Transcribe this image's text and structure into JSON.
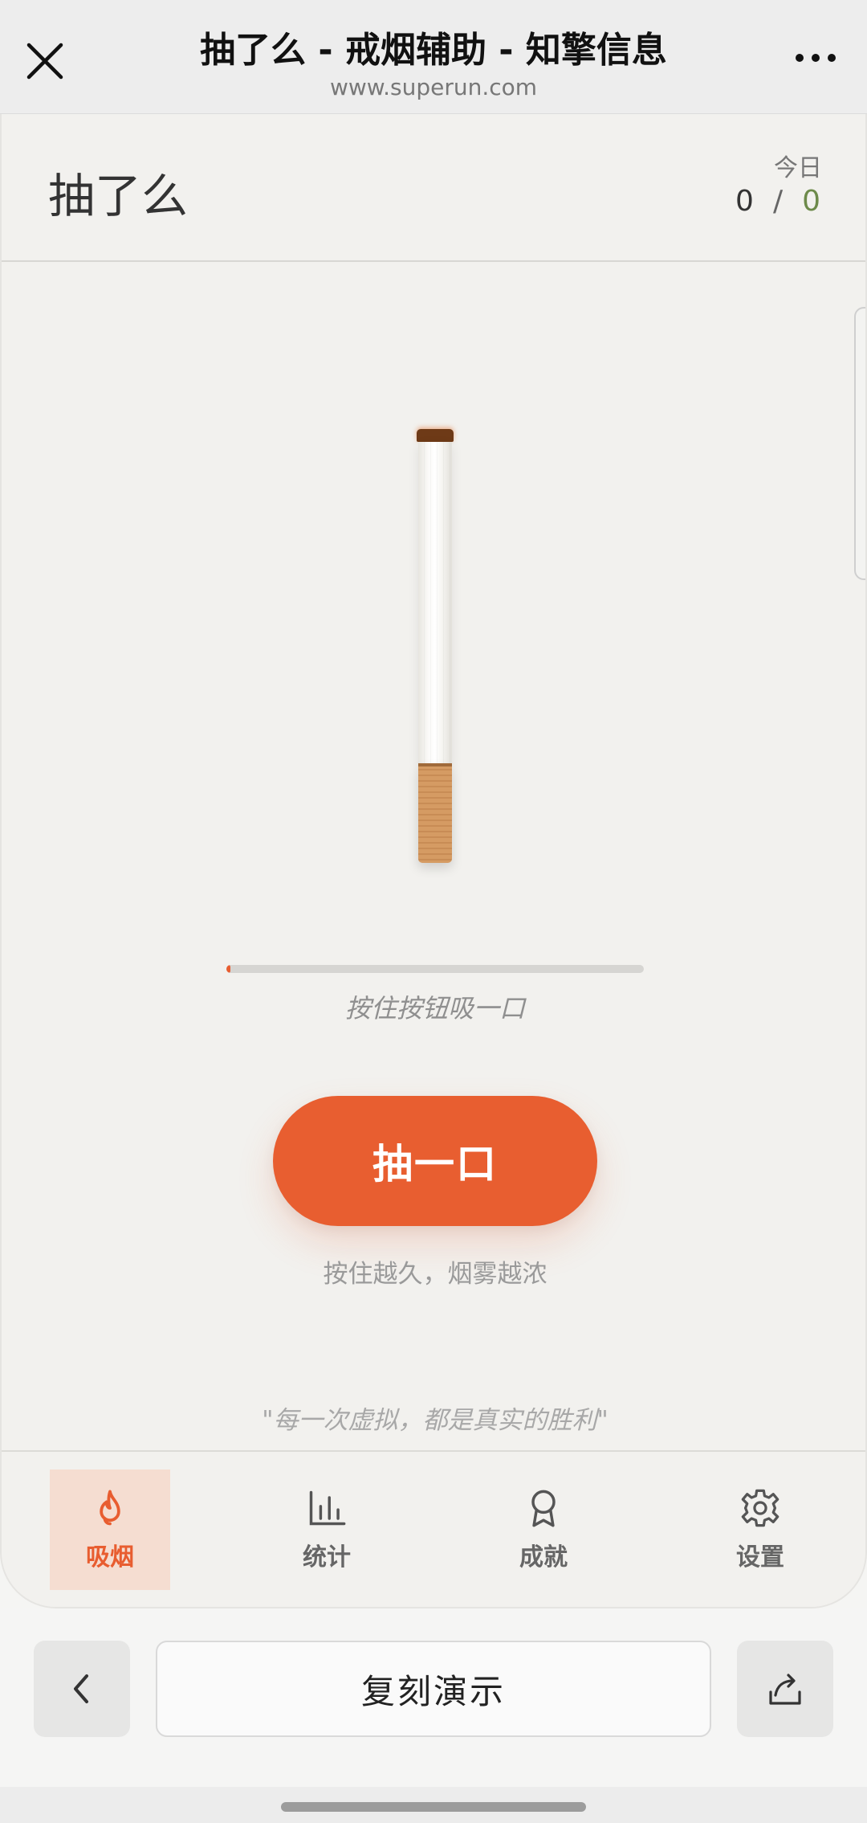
{
  "browser": {
    "title": "抽了么 - 戒烟辅助 - 知擎信息",
    "url": "www.superun.com"
  },
  "header": {
    "app_title": "抽了么",
    "today_label": "今日",
    "today_smoked": "0",
    "separator": "/",
    "today_limit": "0"
  },
  "smoking": {
    "progress_fraction": 0.01,
    "progress_hint": "按住按钮吸一口",
    "button_label": "抽一口",
    "sub_hint": "按住越久，烟雾越浓",
    "quote": "\"每一次虚拟，都是真实的胜利\""
  },
  "nav": {
    "items": [
      {
        "label": "吸烟",
        "icon": "flame-icon",
        "active": true
      },
      {
        "label": "统计",
        "icon": "bar-chart-icon",
        "active": false
      },
      {
        "label": "成就",
        "icon": "award-icon",
        "active": false
      },
      {
        "label": "设置",
        "icon": "gear-icon",
        "active": false
      }
    ]
  },
  "host_bar": {
    "main_label": "复刻演示"
  },
  "colors": {
    "accent": "#e85d30",
    "limit_green": "#6d8a4a",
    "background": "#f2f1ee"
  }
}
